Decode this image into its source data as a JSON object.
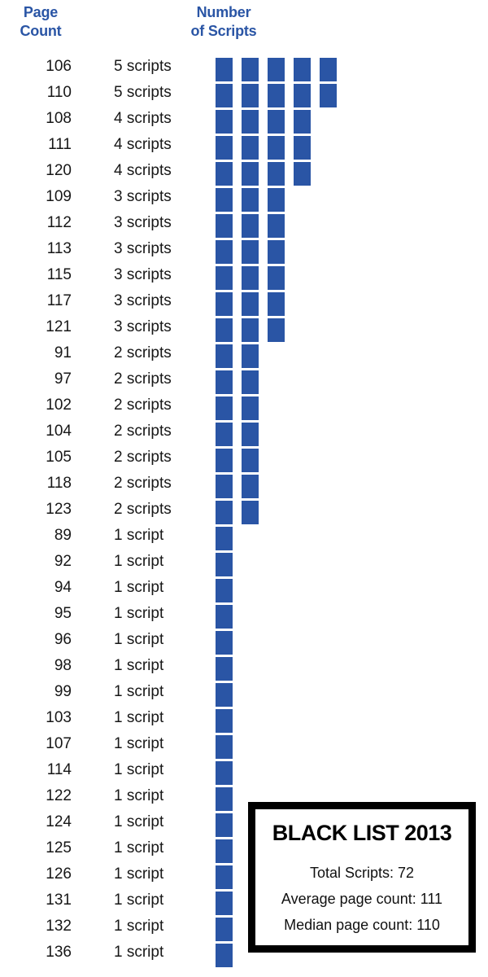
{
  "headers": {
    "page_count": "Page\nCount",
    "number_of_scripts": "Number\nof Scripts"
  },
  "colors": {
    "bar": "#2a55a5",
    "header_text": "#2a55a5",
    "row_text": "#171717",
    "box_border": "#000000",
    "background": "#ffffff"
  },
  "info_box": {
    "title": "BLACK LIST 2013",
    "lines": [
      "Total Scripts: 72",
      "Average page count: 111",
      "Median page count: 110"
    ]
  },
  "chart_data": {
    "type": "bar",
    "title": "BLACK LIST 2013",
    "orientation": "horizontal",
    "xlabel": "Number of Scripts",
    "ylabel": "Page Count",
    "grid": false,
    "legend": false,
    "xlim": [
      0,
      5
    ],
    "unit_glyph": "square",
    "categories": [
      106,
      110,
      108,
      111,
      120,
      109,
      112,
      113,
      115,
      117,
      121,
      91,
      97,
      102,
      104,
      105,
      118,
      123,
      89,
      92,
      94,
      95,
      96,
      98,
      99,
      103,
      107,
      114,
      122,
      124,
      125,
      126,
      131,
      132,
      136
    ],
    "values": [
      5,
      5,
      4,
      4,
      4,
      3,
      3,
      3,
      3,
      3,
      3,
      2,
      2,
      2,
      2,
      2,
      2,
      2,
      1,
      1,
      1,
      1,
      1,
      1,
      1,
      1,
      1,
      1,
      1,
      1,
      1,
      1,
      1,
      1,
      1
    ],
    "value_labels": [
      "5 scripts",
      "5 scripts",
      "4 scripts",
      "4 scripts",
      "4 scripts",
      "3 scripts",
      "3 scripts",
      "3 scripts",
      "3 scripts",
      "3 scripts",
      "3 scripts",
      "2 scripts",
      "2 scripts",
      "2 scripts",
      "2 scripts",
      "2 scripts",
      "2 scripts",
      "2 scripts",
      "1 script",
      "1 script",
      "1 script",
      "1 script",
      "1 script",
      "1 script",
      "1 script",
      "1 script",
      "1 script",
      "1 script",
      "1 script",
      "1 script",
      "1 script",
      "1 script",
      "1 script",
      "1 script",
      "1 script"
    ],
    "annotations": {
      "total_scripts": 72,
      "average_page_count": 111,
      "median_page_count": 110
    }
  },
  "rows": [
    {
      "pages": "106",
      "label": "5 scripts",
      "count": 5
    },
    {
      "pages": "110",
      "label": "5 scripts",
      "count": 5
    },
    {
      "pages": "108",
      "label": "4 scripts",
      "count": 4
    },
    {
      "pages": "111",
      "label": "4 scripts",
      "count": 4
    },
    {
      "pages": "120",
      "label": "4 scripts",
      "count": 4
    },
    {
      "pages": "109",
      "label": "3 scripts",
      "count": 3
    },
    {
      "pages": "112",
      "label": "3 scripts",
      "count": 3
    },
    {
      "pages": "113",
      "label": "3 scripts",
      "count": 3
    },
    {
      "pages": "115",
      "label": "3 scripts",
      "count": 3
    },
    {
      "pages": "117",
      "label": "3 scripts",
      "count": 3
    },
    {
      "pages": "121",
      "label": "3 scripts",
      "count": 3
    },
    {
      "pages": "91",
      "label": "2 scripts",
      "count": 2
    },
    {
      "pages": "97",
      "label": "2 scripts",
      "count": 2
    },
    {
      "pages": "102",
      "label": "2 scripts",
      "count": 2
    },
    {
      "pages": "104",
      "label": "2 scripts",
      "count": 2
    },
    {
      "pages": "105",
      "label": "2 scripts",
      "count": 2
    },
    {
      "pages": "118",
      "label": "2 scripts",
      "count": 2
    },
    {
      "pages": "123",
      "label": "2 scripts",
      "count": 2
    },
    {
      "pages": "89",
      "label": "1 script",
      "count": 1
    },
    {
      "pages": "92",
      "label": "1 script",
      "count": 1
    },
    {
      "pages": "94",
      "label": "1 script",
      "count": 1
    },
    {
      "pages": "95",
      "label": "1 script",
      "count": 1
    },
    {
      "pages": "96",
      "label": "1 script",
      "count": 1
    },
    {
      "pages": "98",
      "label": "1 script",
      "count": 1
    },
    {
      "pages": "99",
      "label": "1 script",
      "count": 1
    },
    {
      "pages": "103",
      "label": "1 script",
      "count": 1
    },
    {
      "pages": "107",
      "label": "1 script",
      "count": 1
    },
    {
      "pages": "114",
      "label": "1 script",
      "count": 1
    },
    {
      "pages": "122",
      "label": "1 script",
      "count": 1
    },
    {
      "pages": "124",
      "label": "1 script",
      "count": 1
    },
    {
      "pages": "125",
      "label": "1 script",
      "count": 1
    },
    {
      "pages": "126",
      "label": "1 script",
      "count": 1
    },
    {
      "pages": "131",
      "label": "1 script",
      "count": 1
    },
    {
      "pages": "132",
      "label": "1 script",
      "count": 1
    },
    {
      "pages": "136",
      "label": "1 script",
      "count": 1
    }
  ]
}
